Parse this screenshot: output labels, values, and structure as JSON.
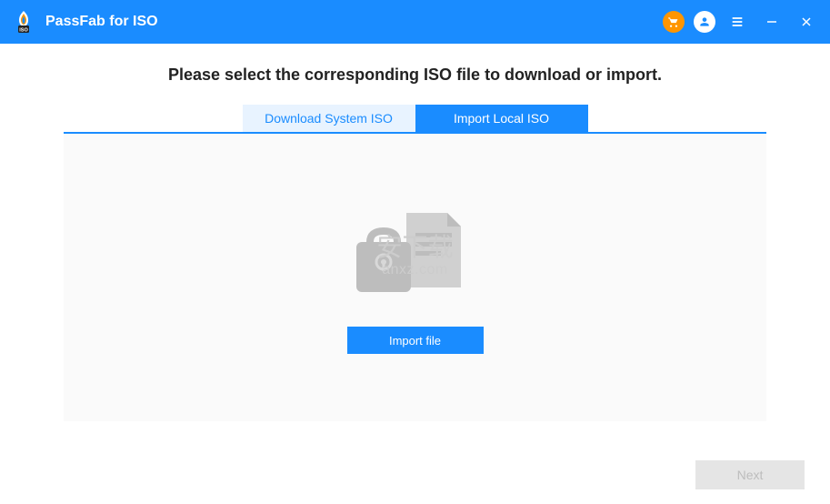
{
  "titlebar": {
    "app_title": "PassFab for ISO"
  },
  "page": {
    "heading": "Please select the corresponding ISO file to download or import."
  },
  "tabs": {
    "download": "Download System ISO",
    "import": "Import Local ISO",
    "active": "import"
  },
  "actions": {
    "import_file": "Import file",
    "next": "Next"
  },
  "watermark": {
    "top": "安下载",
    "bottom": "anxz.com"
  },
  "colors": {
    "primary": "#1a8cff",
    "accent": "#ff9500"
  }
}
